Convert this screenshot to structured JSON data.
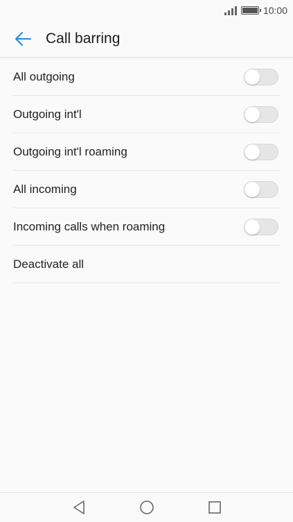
{
  "status_bar": {
    "time": "10:00",
    "signal_icon": "signal-icon",
    "battery_icon": "battery-icon"
  },
  "app_bar": {
    "title": "Call barring",
    "back_icon": "arrow-left-icon",
    "accent_color": "#1e88e5"
  },
  "items": [
    {
      "label": "All outgoing",
      "has_toggle": true,
      "toggle_on": false
    },
    {
      "label": "Outgoing int'l",
      "has_toggle": true,
      "toggle_on": false
    },
    {
      "label": "Outgoing int'l roaming",
      "has_toggle": true,
      "toggle_on": false
    },
    {
      "label": "All incoming",
      "has_toggle": true,
      "toggle_on": false
    },
    {
      "label": "Incoming calls when roaming",
      "has_toggle": true,
      "toggle_on": false
    },
    {
      "label": "Deactivate all",
      "has_toggle": false
    }
  ],
  "nav_bar": {
    "back_icon": "nav-back-triangle-icon",
    "home_icon": "nav-home-circle-icon",
    "recents_icon": "nav-recents-square-icon"
  }
}
